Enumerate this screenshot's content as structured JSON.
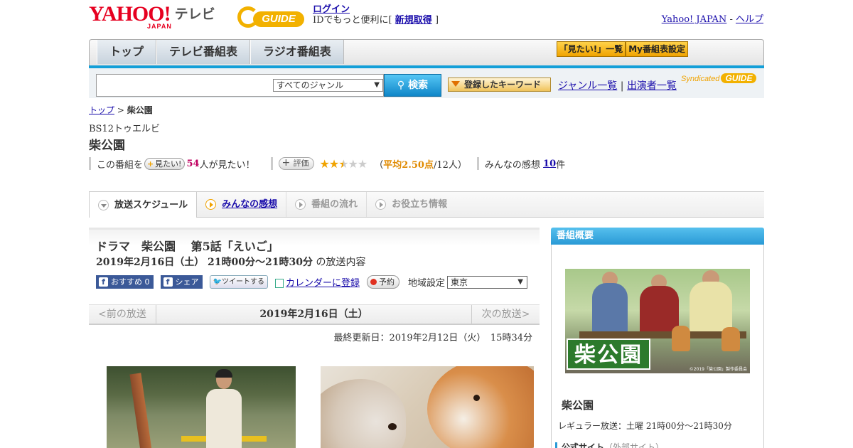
{
  "header": {
    "logo_text": "YAHOO!",
    "logo_sub": "JAPAN",
    "service_name": "テレビ",
    "gguide_text": "GUIDE",
    "login_label": "ログイン",
    "login_desc": "IDでもっと便利に[",
    "signup_label": "新規取得",
    "login_close": "]",
    "yahoo_japan_link": "Yahoo! JAPAN",
    "separator": " - ",
    "help_link": "ヘルプ"
  },
  "nav": {
    "tabs": [
      {
        "label": "トップ"
      },
      {
        "label": "テレビ番組表"
      },
      {
        "label": "ラジオ番組表"
      }
    ],
    "mitai_list_label": "「見たい!」一覧",
    "my_bangumi_label": "My番組表設定"
  },
  "search": {
    "placeholder": "",
    "genre_selected": "すべてのジャンル",
    "search_button": "検索",
    "keyword_button": "登録したキーワード",
    "genre_list_link": "ジャンル一覧",
    "divider": "|",
    "performer_list_link": "出演者一覧",
    "syndicated_label": "Syndicated",
    "syndicated_g": "GUIDE"
  },
  "breadcrumb": {
    "top_link": "トップ",
    "sep": " > ",
    "current": "柴公園"
  },
  "program": {
    "channel": "BS12トゥエルビ",
    "title": "柴公園",
    "mitai_prefix": "この番組を",
    "mitai_button": "見たい!",
    "mitai_count": "54",
    "mitai_suffix": "人が見たい！",
    "hyouka_button": "評価",
    "rating_stars": 2.5,
    "rating_open": "（",
    "rating_avg": "平均2.50点",
    "rating_people": "/12人）",
    "kansou_label": "みんなの感想",
    "kansou_count": "10",
    "kansou_unit": "件"
  },
  "subtabs": [
    {
      "label": "放送スケジュール",
      "state": "active"
    },
    {
      "label": "みんなの感想",
      "state": "link"
    },
    {
      "label": "番組の流れ",
      "state": "disabled"
    },
    {
      "label": "お役立ち情報",
      "state": "disabled"
    }
  ],
  "episode": {
    "title": "ドラマ　柴公園　 第5話「えいご」",
    "datetime": "2019年2月16日（土） 21時00分～21時30分",
    "datetime_suffix": "の放送内容",
    "fb_recommend": "おすすめ 0",
    "fb_share": "シェア",
    "tweet": "ツイートする",
    "calendar": "カレンダーに登録",
    "yoyaku": "予約",
    "region_label": "地域設定",
    "region_selected": "東京"
  },
  "datenav": {
    "prev": "<前の放送",
    "current": "2019年2月16日（土）",
    "next": "次の放送>",
    "updated": "最終更新日：2019年2月12日（火）　15時34分"
  },
  "sidebar": {
    "heading": "番組概要",
    "image_logo": "柴公園",
    "image_copyright": "©2019「柴公園」製作委員会",
    "name": "柴公園",
    "regular": "レギュラー放送：土曜 21時00分～21時30分",
    "official_label": "公式サイト",
    "official_note": "（外部サイト）"
  },
  "colors": {
    "accent_blue": "#139fd8",
    "brand_red": "#e60020",
    "gguide_yellow": "#f2b100"
  }
}
